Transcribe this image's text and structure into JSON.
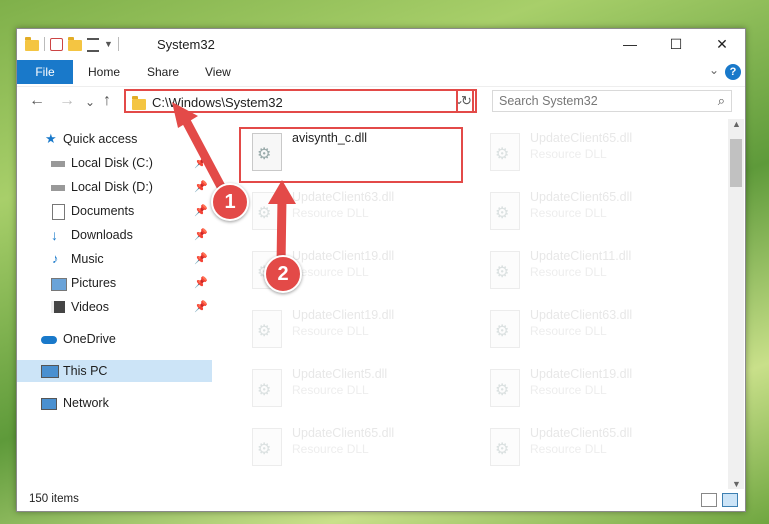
{
  "window": {
    "title": "System32",
    "controls": {
      "minimize": "—",
      "maximize": "☐",
      "close": "✕"
    }
  },
  "ribbon": {
    "tabs": [
      "File",
      "Home",
      "Share",
      "View"
    ],
    "help": "?",
    "collapse": "⌄"
  },
  "nav": {
    "back": "←",
    "forward": "→",
    "recent": "⌄",
    "up": "↑",
    "address": "C:\\Windows\\System32",
    "address_dropdown": "⌄",
    "refresh": "↻",
    "search_placeholder": "Search System32",
    "search_icon": "⌕"
  },
  "sidebar": {
    "items": [
      {
        "label": "Quick access",
        "icon": "star-icon"
      },
      {
        "label": "Local Disk (C:)",
        "icon": "drive-icon",
        "pinned": true
      },
      {
        "label": "Local Disk (D:)",
        "icon": "drive-icon",
        "pinned": true
      },
      {
        "label": "Documents",
        "icon": "documents-icon",
        "pinned": true
      },
      {
        "label": "Downloads",
        "icon": "downloads-icon",
        "pinned": true
      },
      {
        "label": "Music",
        "icon": "music-icon",
        "pinned": true
      },
      {
        "label": "Pictures",
        "icon": "pictures-icon",
        "pinned": true
      },
      {
        "label": "Videos",
        "icon": "videos-icon",
        "pinned": true
      },
      {
        "label": "OneDrive",
        "icon": "onedrive-icon"
      },
      {
        "label": "This PC",
        "icon": "pc-icon",
        "selected": true
      },
      {
        "label": "Network",
        "icon": "network-icon"
      }
    ],
    "pin_glyph": "📌"
  },
  "files": [
    {
      "name": "avisynth_c.dll",
      "type": ""
    },
    {
      "name": "UpdateClient65.dll",
      "type": "Resource DLL"
    },
    {
      "name": "UpdateClient63.dll",
      "type": "Resource DLL"
    },
    {
      "name": "UpdateClient65.dll",
      "type": "Resource DLL"
    },
    {
      "name": "UpdateClient19.dll",
      "type": "Resource DLL"
    },
    {
      "name": "UpdateClient11.dll",
      "type": "Resource DLL"
    },
    {
      "name": "UpdateClient19.dll",
      "type": "Resource DLL"
    },
    {
      "name": "UpdateClient63.dll",
      "type": "Resource DLL"
    },
    {
      "name": "UpdateClient5.dll",
      "type": "Resource DLL"
    },
    {
      "name": "UpdateClient19.dll",
      "type": "Resource DLL"
    },
    {
      "name": "UpdateClient65.dll",
      "type": "Resource DLL"
    },
    {
      "name": "UpdateClient65.dll",
      "type": "Resource DLL"
    }
  ],
  "status": {
    "count": "150 items"
  },
  "annotations": {
    "step1": "1",
    "step2": "2"
  },
  "colors": {
    "accent": "#1979ca",
    "annotation": "#e34a48",
    "selection": "#cce4f7"
  }
}
